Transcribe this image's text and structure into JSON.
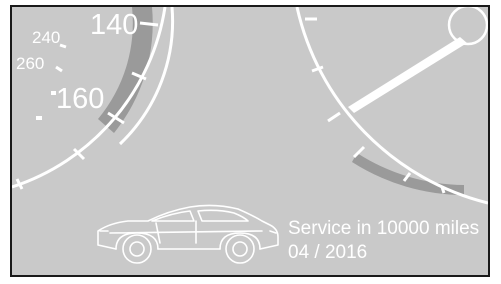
{
  "speedometer": {
    "labels": {
      "s140": "140",
      "s160": "160",
      "s240": "240",
      "s260": "260"
    }
  },
  "service": {
    "line1": "Service in 10000 miles",
    "line2": "04 / 2016"
  },
  "icons": {
    "car": "car-icon"
  },
  "colors": {
    "display_background": "#c9c9c9",
    "gauge_white": "#ffffff",
    "gauge_band": "#9a9a9a",
    "frame": "#1a1a1a"
  }
}
